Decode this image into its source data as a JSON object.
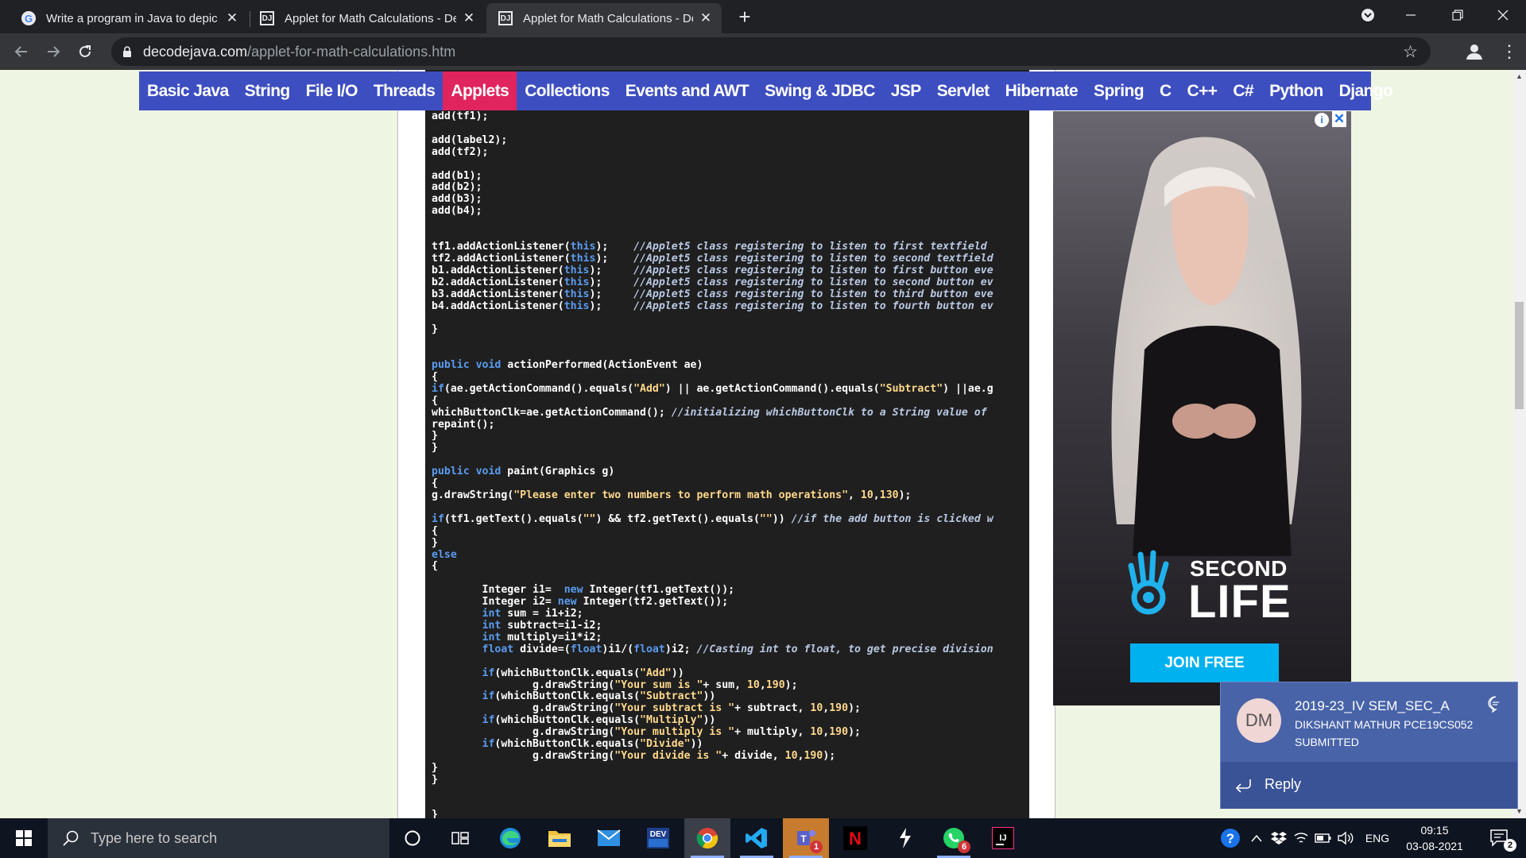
{
  "browser": {
    "tabs": [
      {
        "title": "Write a program in Java to depic",
        "favicon": "google-icon",
        "active": false
      },
      {
        "title": "Applet for Math Calculations - De",
        "favicon": "decodejava-icon",
        "active": false
      },
      {
        "title": "Applet for Math Calculations - De",
        "favicon": "decodejava-icon",
        "active": true
      }
    ],
    "url_domain": "decodejava.com",
    "url_path": "/applet-for-math-calculations.htm"
  },
  "site_nav": {
    "items": [
      "Basic Java",
      "String",
      "File I/O",
      "Threads",
      "Applets",
      "Collections",
      "Events and AWT",
      "Swing & JDBC",
      "JSP",
      "Servlet",
      "Hibernate",
      "Spring",
      "C",
      "C++",
      "C#",
      "Python",
      "Django"
    ],
    "active": "Applets",
    "colors": {
      "bar": "#3d4ec0",
      "active": "#e0245e"
    }
  },
  "code_lines": [
    "add(tf1);",
    "",
    "add(label2);",
    "add(tf2);",
    "",
    "add(b1);",
    "add(b2);",
    "add(b3);",
    "add(b4);",
    "",
    "",
    "tf1.addActionListener(this);    //Applet5 class registering to listen to first textfield",
    "tf2.addActionListener(this);    //Applet5 class registering to listen to second textfield",
    "b1.addActionListener(this);     //Applet5 class registering to listen to first button eve",
    "b2.addActionListener(this);     //Applet5 class registering to listen to second button ev",
    "b3.addActionListener(this);     //Applet5 class registering to listen to third button eve",
    "b4.addActionListener(this);     //Applet5 class registering to listen to fourth button ev",
    "",
    "}",
    "",
    "",
    "public void actionPerformed(ActionEvent ae)",
    "{",
    "if(ae.getActionCommand().equals(\"Add\") || ae.getActionCommand().equals(\"Subtract\") ||ae.g",
    "{",
    "whichButtonClk=ae.getActionCommand(); //initializing whichButtonClk to a String value of",
    "repaint();",
    "}",
    "}",
    "",
    "public void paint(Graphics g)",
    "{",
    "g.drawString(\"Please enter two numbers to perform math operations\", 10,130);",
    "",
    "if(tf1.getText().equals(\"\") && tf2.getText().equals(\"\")) //if the add button is clicked w",
    "{",
    "}",
    "else",
    "{",
    "",
    "        Integer i1=  new Integer(tf1.getText());",
    "        Integer i2= new Integer(tf2.getText());",
    "        int sum = i1+i2;",
    "        int subtract=i1-i2;",
    "        int multiply=i1*i2;",
    "        float divide=(float)i1/(float)i2; //Casting int to float, to get precise division",
    "",
    "        if(whichButtonClk.equals(\"Add\"))",
    "                g.drawString(\"Your sum is \"+ sum, 10,190);",
    "        if(whichButtonClk.equals(\"Subtract\"))",
    "                g.drawString(\"Your subtract is \"+ subtract, 10,190);",
    "        if(whichButtonClk.equals(\"Multiply\"))",
    "                g.drawString(\"Your multiply is \"+ multiply, 10,190);",
    "        if(whichButtonClk.equals(\"Divide\"))",
    "                g.drawString(\"Your divide is \"+ divide, 10,190);",
    "}",
    "}",
    "",
    "",
    "}"
  ],
  "ad": {
    "brand_line1": "SECOND",
    "brand_line2": "LIFE",
    "cta": "JOIN FREE",
    "info_label": "i",
    "close_label": "✕"
  },
  "toast": {
    "avatar": "DM",
    "title": "2019-23_IV SEM_SEC_A",
    "line1": "DIKSHANT MATHUR PCE19CS052",
    "line2": "SUBMITTED",
    "reply": "Reply"
  },
  "taskbar": {
    "search_placeholder": "Type here to search",
    "apps": [
      {
        "name": "cortana-icon"
      },
      {
        "name": "task-view-icon"
      },
      {
        "name": "edge-icon"
      },
      {
        "name": "file-explorer-icon"
      },
      {
        "name": "mail-icon"
      },
      {
        "name": "devcpp-icon",
        "label": "DEV"
      },
      {
        "name": "chrome-icon"
      },
      {
        "name": "vscode-icon"
      },
      {
        "name": "teams-icon",
        "badge": "1"
      },
      {
        "name": "netflix-icon",
        "label": "N"
      },
      {
        "name": "sublime-icon"
      },
      {
        "name": "whatsapp-icon",
        "badge": "6"
      },
      {
        "name": "intellij-icon",
        "label": "IJ"
      }
    ],
    "language": "ENG",
    "time": "09:15",
    "date": "03-08-2021",
    "notification_count": "2"
  }
}
